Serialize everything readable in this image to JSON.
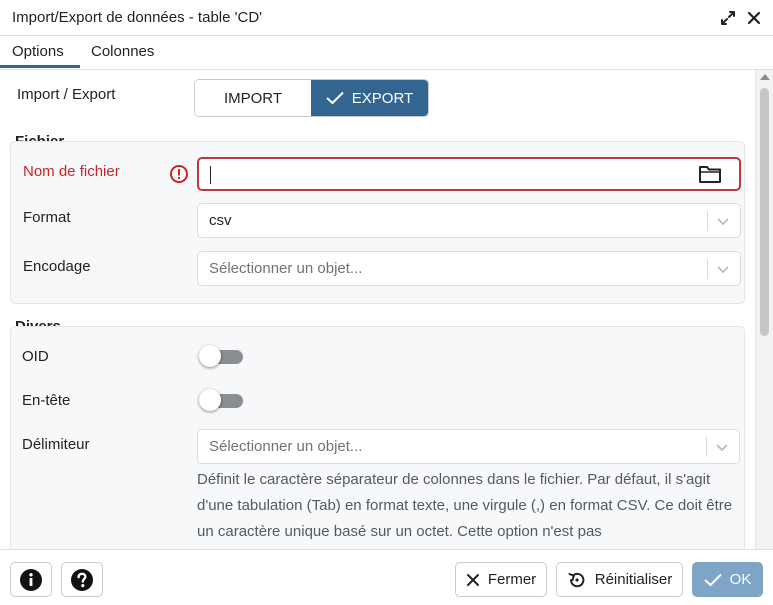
{
  "dialog": {
    "title": "Import/Export de données - table 'CD'",
    "icons": {
      "maximize": "expand-arrows-icon",
      "close": "close-icon"
    }
  },
  "tabs": [
    {
      "label": "Options",
      "active": true
    },
    {
      "label": "Colonnes",
      "active": false
    }
  ],
  "import_export": {
    "label": "Import / Export",
    "import_label": "IMPORT",
    "export_label": "EXPORT",
    "selected": "EXPORT"
  },
  "fichier": {
    "section_title": "Fichier",
    "filename_label": "Nom de fichier",
    "filename_value": "",
    "filename_has_error": true,
    "format_label": "Format",
    "format_value": "csv",
    "encoding_label": "Encodage",
    "encoding_placeholder": "Sélectionner un objet..."
  },
  "divers": {
    "section_title": "Divers",
    "oid_label": "OID",
    "oid_on": false,
    "header_label": "En-tête",
    "header_on": false,
    "delimiter_label": "Délimiteur",
    "delimiter_placeholder": "Sélectionner un objet...",
    "delimiter_help": "Définit le caractère séparateur de colonnes dans le fichier. Par défaut, il s'agit d'une tabulation (Tab) en format texte, une virgule (,) en format CSV. Ce doit être un caractère unique basé sur un octet. Cette option n'est pas"
  },
  "footer": {
    "close_label": "Fermer",
    "reset_label": "Réinitialiser",
    "ok_label": "OK"
  },
  "colors": {
    "accent": "#326690",
    "error": "#c7252a",
    "ok_disabled": "#7ea4c6"
  }
}
